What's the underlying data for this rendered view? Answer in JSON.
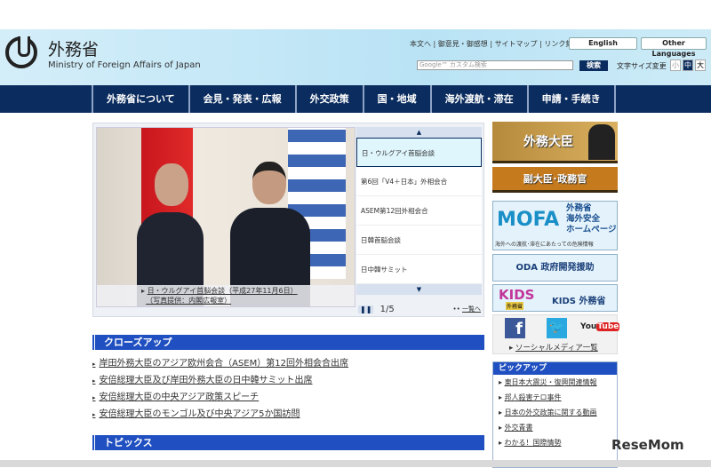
{
  "header": {
    "site_name_jp": "外務省",
    "site_name_en": "Ministry of Foreign Affairs of Japan",
    "top_links": [
      "本文へ",
      "御意見・御感想",
      "サイトマップ",
      "リンク集"
    ],
    "english": "English",
    "other_languages": "Other Languages",
    "search_placeholder": "Google™ カスタム検索",
    "search_button": "検索",
    "font_size_label": "文字サイズ変更",
    "font_sizes": [
      "小",
      "中",
      "大"
    ]
  },
  "nav": [
    "外務省について",
    "会見・発表・広報",
    "外交政策",
    "国・地域",
    "海外渡航・滞在",
    "申請・手続き"
  ],
  "slider": {
    "caption_line1": "日・ウルグアイ首脳会談（平成27年11月6日）",
    "caption_line2": "（写真提供：内閣広報室）",
    "items": [
      "日・ウルグアイ首脳会談",
      "第6回「V4＋日本」外相会合",
      "ASEM第12回外相会合",
      "日韓首脳会談",
      "日中韓サミット"
    ],
    "counter": "1/5",
    "list_link": "一覧へ"
  },
  "closeup": {
    "title": "クローズアップ",
    "items": [
      "岸田外務大臣のアジア欧州会合（ASEM）第12回外相会合出席",
      "安倍総理大臣及び岸田外務大臣の日中韓サミット出席",
      "安倍総理大臣の中央アジア政策スピーチ",
      "安倍総理大臣のモンゴル及び中央アジア5か国訪問"
    ]
  },
  "topics": {
    "title": "トピックス"
  },
  "sidebar": {
    "minister": "外務大臣",
    "vice": "副大臣･政務官",
    "mofa_logo": "MOFA",
    "mofa_text": [
      "外務省",
      "海外安全",
      "ホームページ"
    ],
    "mofa_sub": "海外への渡航･滞在にあたっての危険情報",
    "oda": "ODA 政府開発援助",
    "kids_logo": "KIDS",
    "kids_logo_sub": "外務省",
    "kids": "KIDS 外務省",
    "facebook": "f",
    "youtube": "YouTube",
    "social_link": "ソーシャルメディア一覧"
  },
  "pickup": {
    "title": "ピックアップ",
    "items": [
      "東日本大震災・復興関連情報",
      "邦人殺害テロ事件",
      "日本の外交政策に関する動画",
      "外交青書",
      "わかる！国際情勢"
    ]
  },
  "watermark": "ReseMom"
}
